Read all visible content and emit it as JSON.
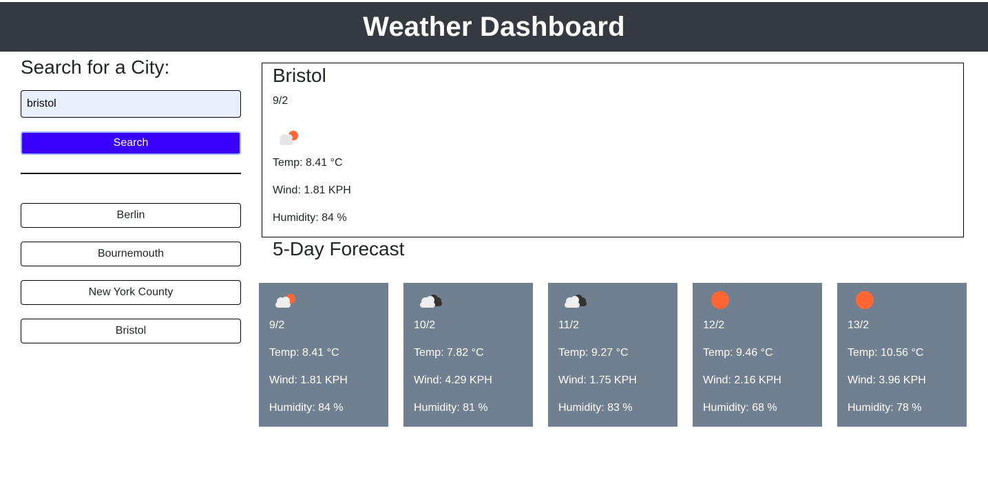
{
  "header": {
    "title": "Weather Dashboard"
  },
  "sidebar": {
    "heading": "Search for a City:",
    "search_value": "bristol",
    "search_button": "Search",
    "history": [
      "Berlin",
      "Bournemouth",
      "New York County",
      "Bristol"
    ]
  },
  "current": {
    "city": "Bristol",
    "date": "9/2",
    "icon": "cloud-sun-icon",
    "temp": "Temp: 8.41 °C",
    "wind": "Wind: 1.81 KPH",
    "humidity": "Humidity: 84 %"
  },
  "forecast": {
    "title": "5-Day Forecast",
    "days": [
      {
        "date": "9/2",
        "icon": "cloud-sun-icon",
        "temp": "Temp: 8.41 °C",
        "wind": "Wind: 1.81 KPH",
        "humidity": "Humidity: 84 %"
      },
      {
        "date": "10/2",
        "icon": "cloud-dark-icon",
        "temp": "Temp: 7.82 °C",
        "wind": "Wind: 4.29 KPH",
        "humidity": "Humidity: 81 %"
      },
      {
        "date": "11/2",
        "icon": "cloud-dark-icon",
        "temp": "Temp: 9.27 °C",
        "wind": "Wind: 1.75 KPH",
        "humidity": "Humidity: 83 %"
      },
      {
        "date": "12/2",
        "icon": "sun-icon",
        "temp": "Temp: 9.46 °C",
        "wind": "Wind: 2.16 KPH",
        "humidity": "Humidity: 68 %"
      },
      {
        "date": "13/2",
        "icon": "sun-icon",
        "temp": "Temp: 10.56 °C",
        "wind": "Wind: 3.96 KPH",
        "humidity": "Humidity: 78 %"
      }
    ]
  },
  "colors": {
    "header_bg": "#343a40",
    "search_button_bg": "#3a00ff",
    "card_bg": "#708090",
    "sun": "#ff6633"
  }
}
